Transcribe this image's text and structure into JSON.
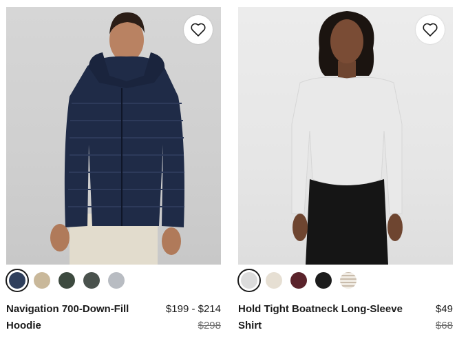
{
  "products": [
    {
      "name": "Navigation 700-Down-Fill Hoodie",
      "price": "$199 - $214",
      "original_price": "$298",
      "swatches": [
        "#2f3f5c",
        "#c9b89a",
        "#3d4a3f",
        "#4a524d",
        "#b8bcc2"
      ],
      "selected_swatch": 0
    },
    {
      "name": "Hold Tight Boatneck Long-Sleeve Shirt",
      "price": "$49",
      "original_price": "$68",
      "swatches": [
        "#dcdcdc",
        "#e6dfd3",
        "#5a232b",
        "#1c1c1c",
        "stripe"
      ],
      "selected_swatch": 0
    }
  ],
  "icons": {
    "favorite": "heart-outline-icon"
  }
}
